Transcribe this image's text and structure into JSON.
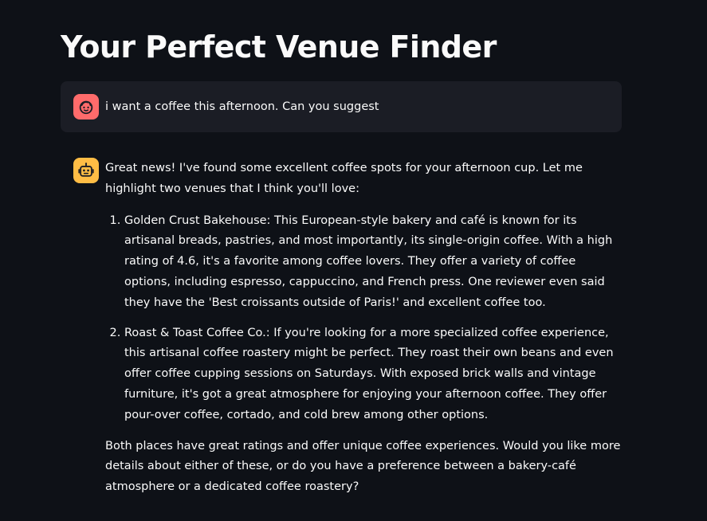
{
  "header": {
    "title": "Your Perfect Venue Finder"
  },
  "chat": {
    "user_message": {
      "avatar_icon": "child-face-icon",
      "avatar_color": "#ff6b6b",
      "text": "i want a coffee this afternoon. Can you suggest"
    },
    "assistant_message": {
      "avatar_icon": "robot-face-icon",
      "avatar_color": "#ffbd45",
      "intro": "Great news! I've found some excellent coffee spots for your afternoon cup. Let me highlight two venues that I think you'll love:",
      "items": [
        {
          "text": "Golden Crust Bakehouse: This European-style bakery and café is known for its artisanal breads, pastries, and most importantly, its single-origin coffee. With a high rating of 4.6, it's a favorite among coffee lovers. They offer a variety of coffee options, including espresso, cappuccino, and French press. One reviewer even said they have the 'Best croissants outside of Paris!' and excellent coffee too."
        },
        {
          "text": "Roast & Toast Coffee Co.: If you're looking for a more specialized coffee experience, this artisanal coffee roastery might be perfect. They roast their own beans and even offer coffee cupping sessions on Saturdays. With exposed brick walls and vintage furniture, it's got a great atmosphere for enjoying your afternoon coffee. They offer pour-over coffee, cortado, and cold brew among other options."
        }
      ],
      "outro": "Both places have great ratings and offer unique coffee experiences. Would you like more details about either of these, or do you have a preference between a bakery-café atmosphere or a dedicated coffee roastery?"
    }
  }
}
